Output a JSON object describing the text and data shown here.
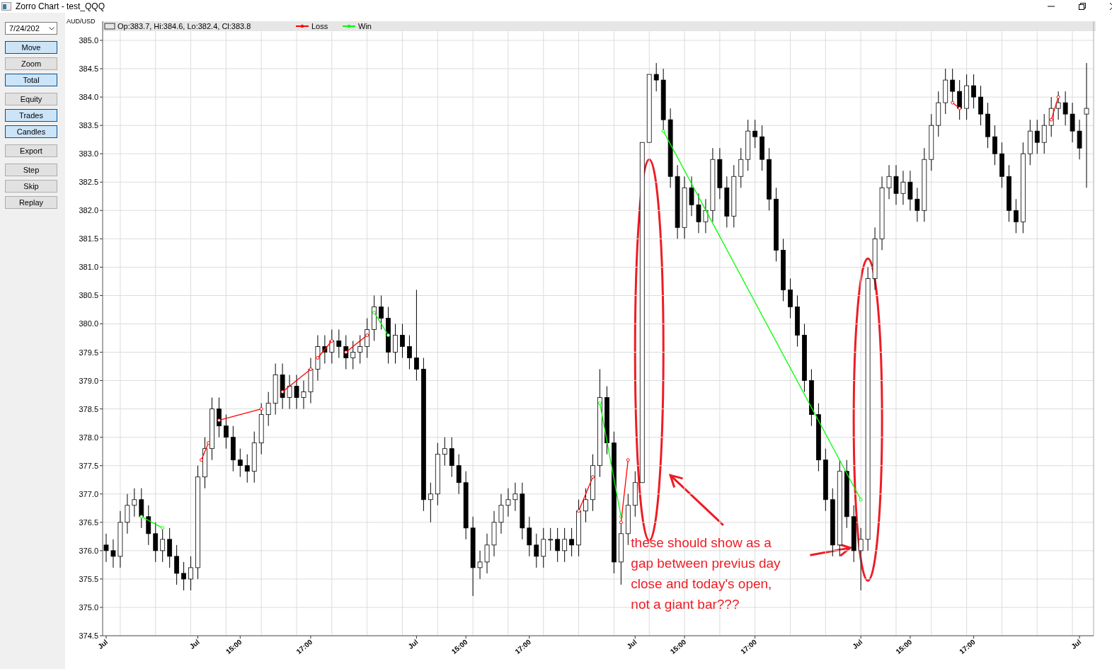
{
  "window": {
    "title": "Zorro Chart - test_QQQ"
  },
  "sidebar": {
    "date": "7/24/202",
    "button_groups": [
      [
        {
          "label": "Move",
          "selected": true
        },
        {
          "label": "Zoom",
          "selected": false
        },
        {
          "label": "Total",
          "selected": true
        }
      ],
      [
        {
          "label": "Equity",
          "selected": false
        },
        {
          "label": "Trades",
          "selected": true
        },
        {
          "label": "Candles",
          "selected": true
        }
      ],
      [
        {
          "label": "Export",
          "selected": false
        }
      ],
      [
        {
          "label": "Step",
          "selected": false
        },
        {
          "label": "Skip",
          "selected": false
        },
        {
          "label": "Replay",
          "selected": false
        }
      ]
    ]
  },
  "chart": {
    "asset": "AUD/USD",
    "readout": "Op:383.7, Hi:384.6, Lo:382.4, Cl:383.8",
    "legend": [
      {
        "kind": "loss",
        "label": "Loss",
        "color": "#ff0000"
      },
      {
        "kind": "win",
        "label": "Win",
        "color": "#00ff00"
      }
    ],
    "chart_data": {
      "type": "candlestick",
      "grid": true,
      "ylim": [
        374.5,
        385.0
      ],
      "yticks": [
        {
          "value": 374.5,
          "label": "374.5"
        },
        {
          "value": 375.0,
          "label": "375.0"
        },
        {
          "value": 375.5,
          "label": "375.5"
        },
        {
          "value": 376.0,
          "label": "376.0"
        },
        {
          "value": 376.5,
          "label": "376.5"
        },
        {
          "value": 377.0,
          "label": "377.0"
        },
        {
          "value": 377.5,
          "label": "377.5"
        },
        {
          "value": 378.0,
          "label": "378.0"
        },
        {
          "value": 378.5,
          "label": "378.5"
        },
        {
          "value": 379.0,
          "label": "379.0"
        },
        {
          "value": 379.5,
          "label": "379.5"
        },
        {
          "value": 380.0,
          "label": "380.0"
        },
        {
          "value": 380.5,
          "label": "380.5"
        },
        {
          "value": 381.0,
          "label": "381.0"
        },
        {
          "value": 381.5,
          "label": "381.5"
        },
        {
          "value": 382.0,
          "label": "382.0"
        },
        {
          "value": 382.5,
          "label": "382.5"
        },
        {
          "value": 383.0,
          "label": "383.0"
        },
        {
          "value": 383.5,
          "label": "383.5"
        },
        {
          "value": 384.0,
          "label": "384.0"
        },
        {
          "value": 384.5,
          "label": "384.5"
        },
        {
          "value": 385.0,
          "label": "385.0"
        }
      ],
      "categories": [
        "Jul",
        null,
        null,
        null,
        null,
        null,
        null,
        null,
        null,
        null,
        null,
        null,
        null,
        "Jul",
        null,
        null,
        null,
        null,
        null,
        "15:00",
        null,
        null,
        null,
        null,
        null,
        null,
        null,
        null,
        null,
        "17:00",
        null,
        null,
        null,
        null,
        null,
        null,
        null,
        null,
        null,
        null,
        null,
        null,
        null,
        null,
        "Jul",
        null,
        null,
        null,
        null,
        null,
        null,
        "15:00",
        null,
        null,
        null,
        null,
        null,
        null,
        null,
        null,
        "17:00",
        null,
        null,
        null,
        null,
        null,
        null,
        null,
        null,
        null,
        null,
        null,
        null,
        null,
        null,
        "Jul",
        null,
        null,
        null,
        null,
        null,
        null,
        "15:00",
        null,
        null,
        null,
        null,
        null,
        null,
        null,
        null,
        null,
        "17:00",
        null,
        null,
        null,
        null,
        null,
        null,
        null,
        null,
        null,
        null,
        null,
        null,
        null,
        null,
        "Jul",
        null,
        null,
        null,
        null,
        null,
        null,
        "15:00",
        null,
        null,
        null,
        null,
        null,
        null,
        null,
        null,
        "17:00",
        null,
        null,
        null,
        null,
        null,
        null,
        null,
        null,
        null,
        null,
        null,
        null,
        null,
        null,
        "Jul",
        null
      ],
      "ohlc": [
        [
          376.1,
          376.3,
          375.8,
          376.0
        ],
        [
          376.0,
          376.2,
          375.7,
          375.9
        ],
        [
          375.9,
          376.7,
          375.7,
          376.5
        ],
        [
          376.5,
          377.0,
          376.3,
          376.8
        ],
        [
          376.8,
          377.1,
          376.6,
          376.9
        ],
        [
          376.9,
          377.1,
          376.4,
          376.6
        ],
        [
          376.6,
          376.8,
          376.1,
          376.3
        ],
        [
          376.3,
          376.5,
          375.8,
          376.0
        ],
        [
          376.0,
          376.4,
          375.8,
          376.2
        ],
        [
          376.2,
          376.4,
          375.7,
          375.9
        ],
        [
          375.9,
          376.1,
          375.4,
          375.6
        ],
        [
          375.6,
          375.8,
          375.3,
          375.5
        ],
        [
          375.5,
          375.9,
          375.3,
          375.7
        ],
        [
          375.7,
          377.5,
          375.5,
          377.3
        ],
        [
          377.3,
          378.0,
          377.1,
          377.8
        ],
        [
          377.8,
          378.7,
          377.6,
          378.5
        ],
        [
          378.5,
          378.7,
          378.0,
          378.2
        ],
        [
          378.2,
          378.4,
          377.8,
          378.0
        ],
        [
          378.0,
          378.2,
          377.4,
          377.6
        ],
        [
          377.6,
          377.8,
          377.3,
          377.5
        ],
        [
          377.5,
          377.7,
          377.2,
          377.4
        ],
        [
          377.4,
          378.1,
          377.2,
          377.9
        ],
        [
          377.9,
          378.6,
          377.7,
          378.4
        ],
        [
          378.4,
          378.8,
          378.2,
          378.6
        ],
        [
          378.6,
          379.3,
          378.4,
          379.1
        ],
        [
          379.1,
          379.3,
          378.5,
          378.7
        ],
        [
          378.7,
          379.1,
          378.5,
          378.9
        ],
        [
          378.9,
          379.1,
          378.5,
          378.7
        ],
        [
          378.7,
          379.0,
          378.5,
          378.8
        ],
        [
          378.8,
          379.4,
          378.6,
          379.2
        ],
        [
          379.2,
          379.8,
          379.0,
          379.6
        ],
        [
          379.6,
          379.8,
          379.3,
          379.5
        ],
        [
          379.5,
          379.9,
          379.3,
          379.7
        ],
        [
          379.7,
          379.9,
          379.4,
          379.6
        ],
        [
          379.6,
          379.8,
          379.2,
          379.4
        ],
        [
          379.4,
          379.7,
          379.2,
          379.5
        ],
        [
          379.5,
          379.8,
          379.3,
          379.6
        ],
        [
          379.6,
          380.1,
          379.4,
          379.9
        ],
        [
          379.9,
          380.5,
          379.7,
          380.3
        ],
        [
          380.3,
          380.5,
          379.9,
          380.1
        ],
        [
          380.1,
          380.3,
          379.3,
          379.5
        ],
        [
          379.5,
          380.0,
          379.3,
          379.8
        ],
        [
          379.8,
          380.0,
          379.4,
          379.6
        ],
        [
          379.6,
          379.8,
          379.2,
          379.4
        ],
        [
          379.4,
          380.6,
          379.0,
          379.2
        ],
        [
          379.2,
          379.4,
          376.7,
          376.9
        ],
        [
          376.9,
          377.2,
          376.5,
          377.0
        ],
        [
          377.0,
          377.9,
          376.8,
          377.7
        ],
        [
          377.7,
          378.0,
          377.5,
          377.8
        ],
        [
          377.8,
          378.0,
          377.3,
          377.5
        ],
        [
          377.5,
          377.7,
          377.0,
          377.2
        ],
        [
          377.2,
          377.4,
          376.2,
          376.4
        ],
        [
          376.4,
          376.6,
          375.2,
          375.7
        ],
        [
          375.7,
          376.0,
          375.5,
          375.8
        ],
        [
          375.8,
          376.3,
          375.6,
          376.1
        ],
        [
          376.1,
          376.7,
          375.9,
          376.5
        ],
        [
          376.5,
          377.0,
          376.3,
          376.8
        ],
        [
          376.8,
          377.1,
          376.6,
          376.9
        ],
        [
          376.9,
          377.2,
          376.7,
          377.0
        ],
        [
          377.0,
          377.2,
          376.2,
          376.4
        ],
        [
          376.4,
          376.6,
          375.9,
          376.1
        ],
        [
          376.1,
          376.3,
          375.7,
          375.9
        ],
        [
          375.9,
          376.4,
          375.7,
          376.2
        ],
        [
          376.2,
          376.4,
          376.0,
          376.2
        ],
        [
          376.2,
          376.4,
          375.8,
          376.0
        ],
        [
          376.0,
          376.4,
          375.8,
          376.2
        ],
        [
          376.2,
          376.4,
          375.9,
          376.1
        ],
        [
          376.1,
          376.9,
          375.9,
          376.7
        ],
        [
          376.7,
          377.1,
          376.5,
          376.9
        ],
        [
          376.9,
          377.7,
          376.7,
          377.5
        ],
        [
          377.5,
          379.2,
          377.3,
          378.7
        ],
        [
          378.7,
          378.9,
          377.7,
          377.9
        ],
        [
          377.9,
          378.1,
          375.6,
          375.8
        ],
        [
          375.8,
          376.5,
          375.4,
          376.3
        ],
        [
          376.3,
          377.0,
          376.1,
          376.8
        ],
        [
          376.8,
          377.4,
          376.6,
          377.2
        ],
        [
          377.2,
          383.2,
          377.2,
          383.2
        ],
        [
          383.2,
          384.4,
          383.2,
          384.4
        ],
        [
          384.4,
          384.6,
          384.1,
          384.3
        ],
        [
          384.3,
          384.5,
          383.4,
          383.6
        ],
        [
          383.6,
          383.8,
          382.4,
          382.6
        ],
        [
          382.6,
          382.8,
          381.5,
          381.7
        ],
        [
          381.7,
          382.6,
          381.5,
          382.4
        ],
        [
          382.4,
          382.6,
          381.9,
          382.1
        ],
        [
          382.1,
          382.3,
          381.6,
          381.8
        ],
        [
          381.8,
          382.2,
          381.6,
          382.0
        ],
        [
          382.0,
          383.1,
          381.8,
          382.9
        ],
        [
          382.9,
          383.1,
          382.2,
          382.4
        ],
        [
          382.4,
          382.6,
          381.7,
          381.9
        ],
        [
          381.9,
          382.8,
          381.7,
          382.6
        ],
        [
          382.6,
          383.1,
          382.4,
          382.9
        ],
        [
          382.9,
          383.6,
          382.7,
          383.4
        ],
        [
          383.4,
          383.6,
          383.1,
          383.3
        ],
        [
          383.3,
          383.5,
          382.7,
          382.9
        ],
        [
          382.9,
          383.1,
          382.0,
          382.2
        ],
        [
          382.2,
          382.4,
          381.1,
          381.3
        ],
        [
          381.3,
          381.5,
          380.4,
          380.6
        ],
        [
          380.6,
          380.8,
          380.1,
          380.3
        ],
        [
          380.3,
          380.5,
          379.6,
          379.8
        ],
        [
          379.8,
          380.0,
          378.8,
          379.0
        ],
        [
          379.0,
          379.2,
          378.2,
          378.4
        ],
        [
          378.4,
          378.6,
          377.4,
          377.6
        ],
        [
          377.6,
          377.8,
          376.7,
          376.9
        ],
        [
          376.9,
          377.1,
          375.9,
          376.1
        ],
        [
          376.1,
          377.6,
          375.9,
          377.4
        ],
        [
          377.4,
          377.6,
          376.4,
          376.6
        ],
        [
          376.6,
          376.8,
          375.8,
          376.0
        ],
        [
          376.0,
          376.4,
          375.3,
          376.2
        ],
        [
          376.2,
          381.0,
          376.0,
          380.8
        ],
        [
          380.8,
          381.7,
          380.6,
          381.5
        ],
        [
          381.5,
          382.6,
          381.3,
          382.4
        ],
        [
          382.4,
          382.8,
          382.2,
          382.6
        ],
        [
          382.6,
          382.8,
          382.1,
          382.3
        ],
        [
          382.3,
          382.7,
          382.1,
          382.5
        ],
        [
          382.5,
          382.7,
          382.0,
          382.2
        ],
        [
          382.2,
          382.4,
          381.8,
          382.0
        ],
        [
          382.0,
          383.1,
          381.8,
          382.9
        ],
        [
          382.9,
          383.7,
          382.7,
          383.5
        ],
        [
          383.5,
          384.1,
          383.3,
          383.9
        ],
        [
          383.9,
          384.5,
          383.7,
          384.3
        ],
        [
          384.3,
          384.5,
          383.9,
          384.1
        ],
        [
          384.1,
          384.3,
          383.6,
          383.8
        ],
        [
          383.8,
          384.4,
          383.6,
          384.2
        ],
        [
          384.2,
          384.4,
          383.8,
          384.0
        ],
        [
          384.0,
          384.2,
          383.5,
          383.7
        ],
        [
          383.7,
          383.9,
          383.1,
          383.3
        ],
        [
          383.3,
          383.5,
          382.8,
          383.0
        ],
        [
          383.0,
          383.2,
          382.4,
          382.6
        ],
        [
          382.6,
          382.8,
          381.8,
          382.0
        ],
        [
          382.0,
          382.2,
          381.6,
          381.8
        ],
        [
          381.8,
          383.2,
          381.6,
          383.0
        ],
        [
          383.0,
          383.6,
          382.8,
          383.4
        ],
        [
          383.4,
          383.6,
          383.0,
          383.2
        ],
        [
          383.2,
          383.7,
          383.0,
          383.5
        ],
        [
          383.5,
          384.0,
          383.3,
          383.8
        ],
        [
          383.8,
          384.1,
          383.6,
          383.9
        ],
        [
          383.9,
          384.1,
          383.5,
          383.7
        ],
        [
          383.7,
          383.9,
          383.2,
          383.4
        ],
        [
          383.4,
          383.6,
          382.9,
          383.1
        ],
        [
          383.7,
          384.6,
          382.4,
          383.8
        ]
      ]
    },
    "note": {
      "lines": [
        "these should show as a",
        "gap between previus day",
        "close and today's open,",
        "not a giant bar???"
      ]
    }
  }
}
